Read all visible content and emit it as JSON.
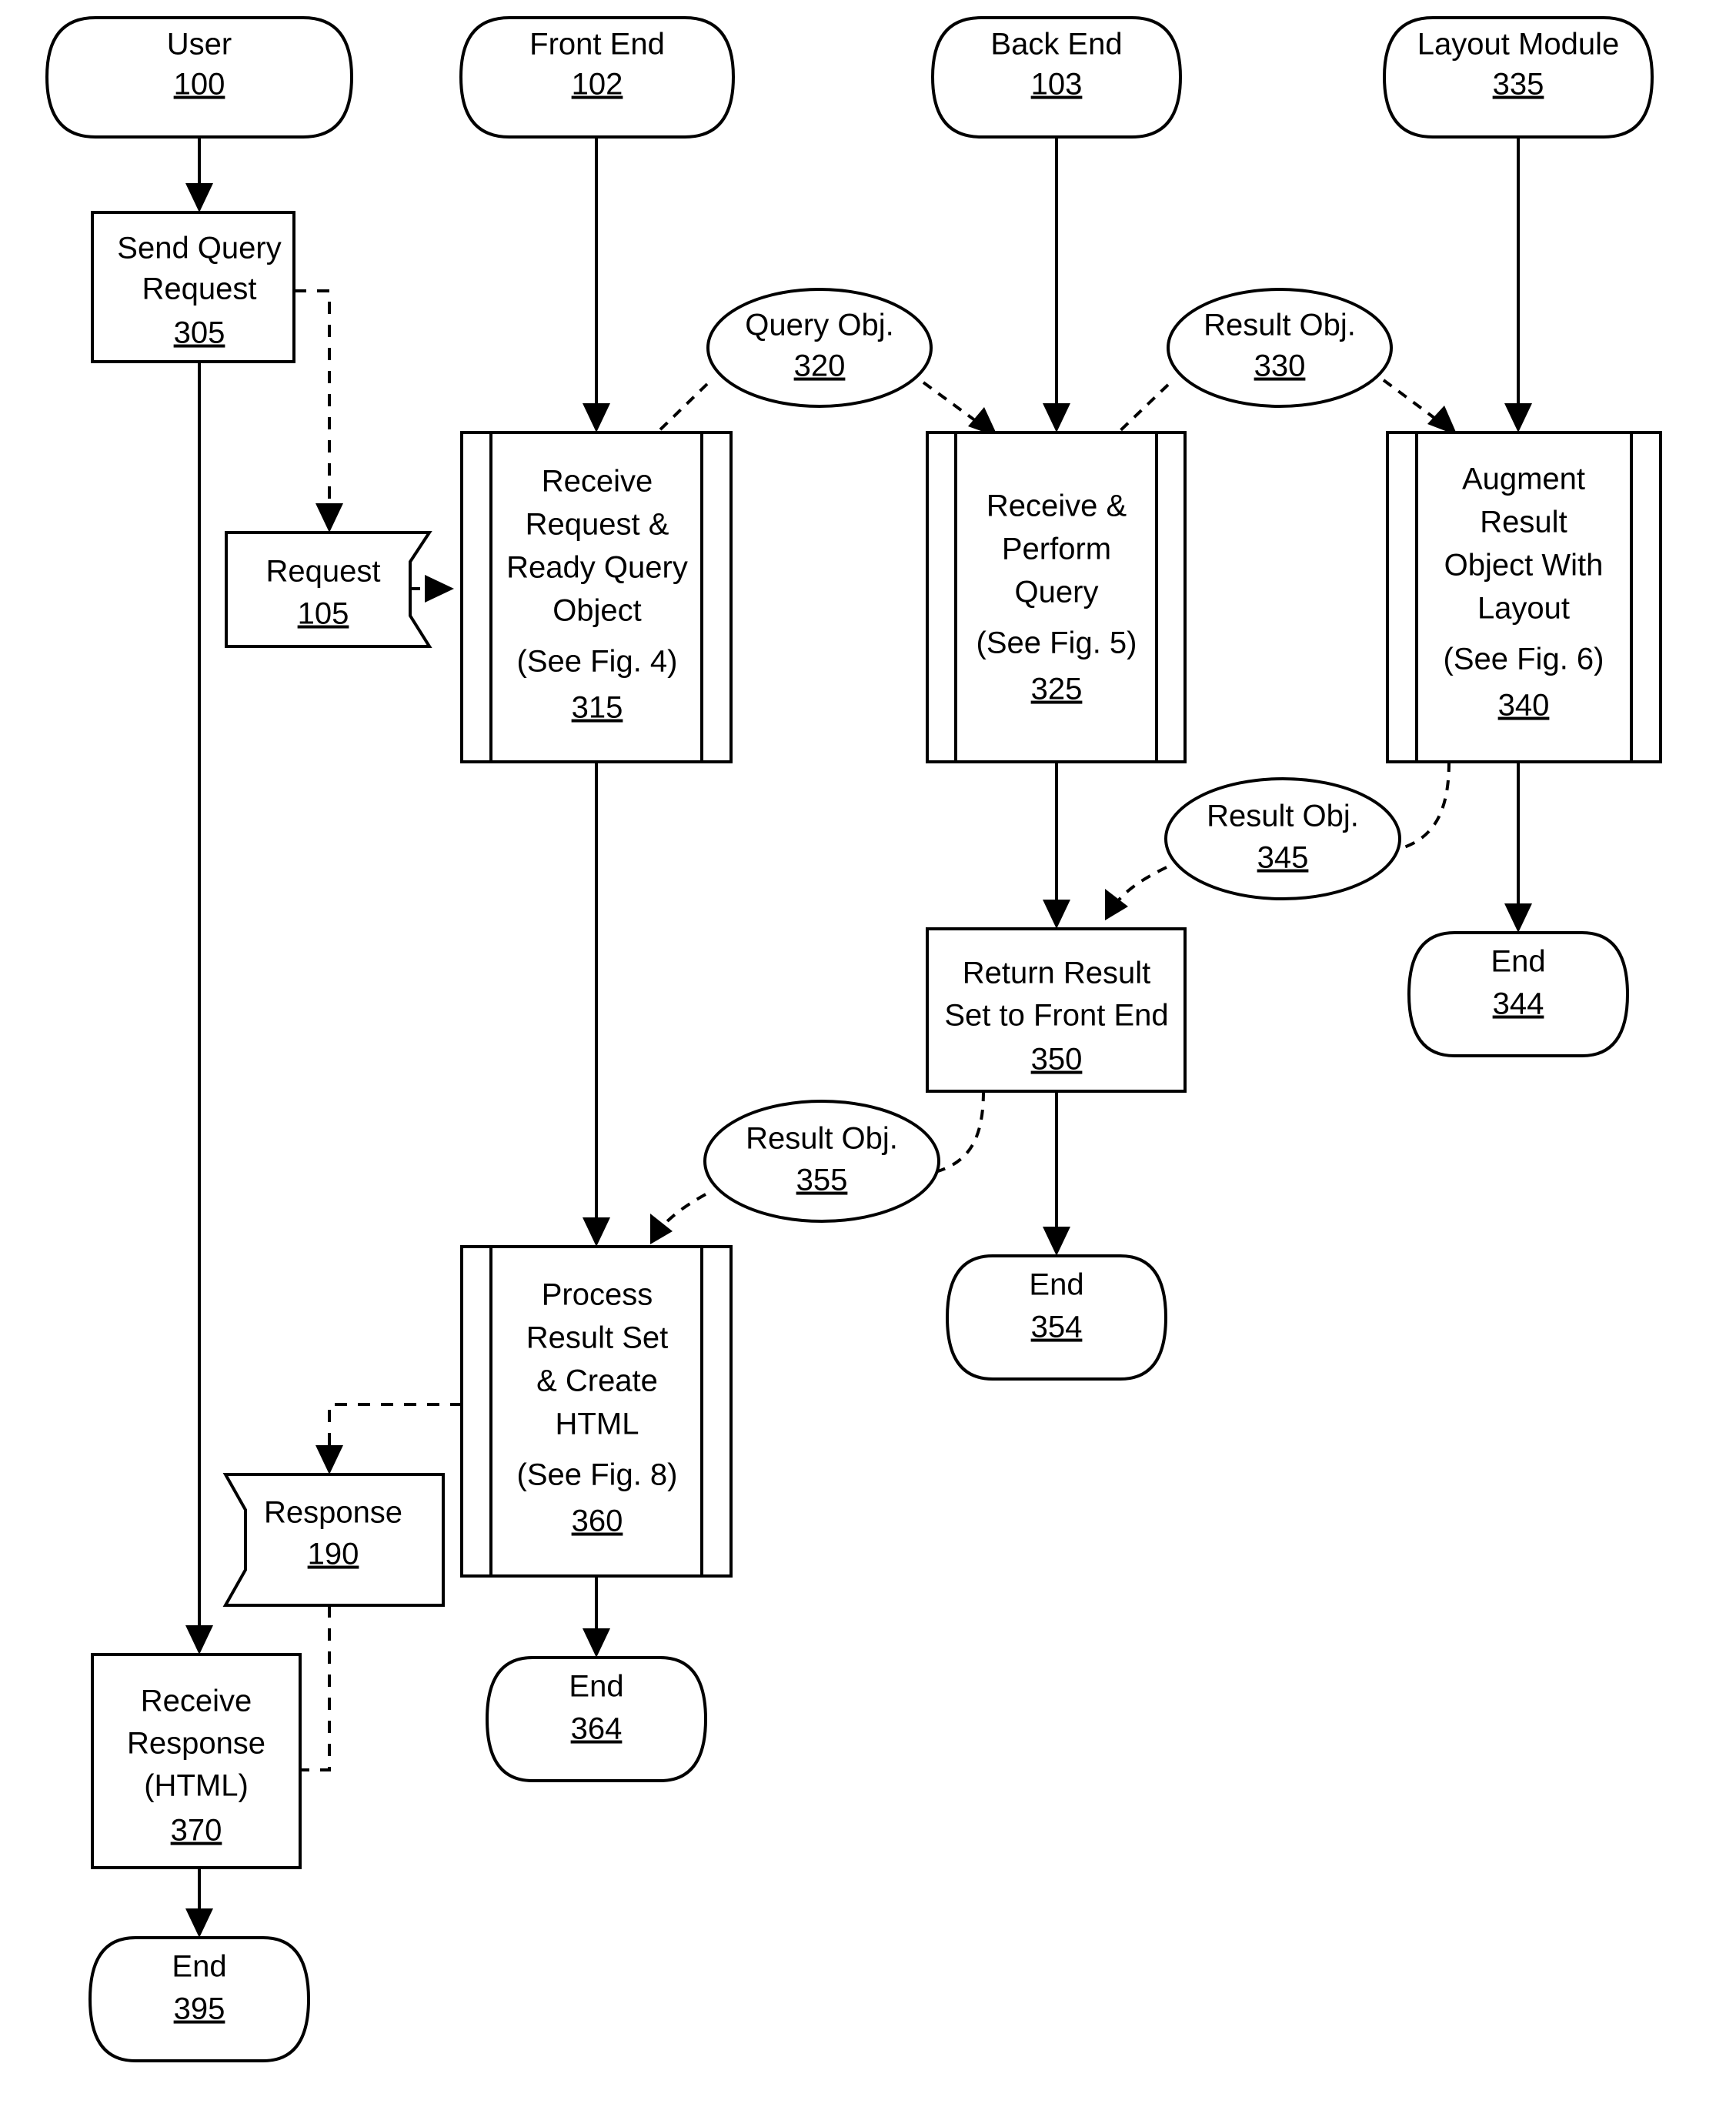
{
  "figure": {
    "type": "patent-flowchart",
    "background_color": "#ffffff",
    "line_color": "#000000"
  },
  "lanes": [
    {
      "name": "user",
      "label": "User",
      "number": "100"
    },
    {
      "name": "front-end",
      "label": "Front End",
      "number": "102"
    },
    {
      "name": "back-end",
      "label": "Back End",
      "number": "103"
    },
    {
      "name": "layout-module",
      "label": "Layout Module",
      "number": "335"
    }
  ],
  "nodes": {
    "send_query_request": {
      "lines": [
        "Send Query",
        "Request"
      ],
      "number": "305",
      "shape": "process"
    },
    "request_doc": {
      "lines": [
        "Request"
      ],
      "number": "105",
      "shape": "flag-right-notch"
    },
    "receive_request_ready_query": {
      "lines": [
        "Receive",
        "Request &",
        "Ready Query",
        "Object",
        "(See Fig. 4)"
      ],
      "number": "315",
      "shape": "predefined-process"
    },
    "query_obj": {
      "lines": [
        "Query Obj."
      ],
      "number": "320",
      "shape": "ellipse"
    },
    "receive_perform_query": {
      "lines": [
        "Receive &",
        "Perform",
        "Query",
        "(See Fig. 5)"
      ],
      "number": "325",
      "shape": "predefined-process"
    },
    "result_obj_330": {
      "lines": [
        "Result Obj."
      ],
      "number": "330",
      "shape": "ellipse"
    },
    "augment_result_object": {
      "lines": [
        "Augment",
        "Result",
        "Object With",
        "Layout",
        "(See Fig. 6)"
      ],
      "number": "340",
      "shape": "predefined-process"
    },
    "end_344": {
      "lines": [
        "End"
      ],
      "number": "344",
      "shape": "terminator"
    },
    "result_obj_345": {
      "lines": [
        "Result Obj."
      ],
      "number": "345",
      "shape": "ellipse"
    },
    "return_result_set": {
      "lines": [
        "Return Result",
        "Set to Front End"
      ],
      "number": "350",
      "shape": "process"
    },
    "end_354": {
      "lines": [
        "End"
      ],
      "number": "354",
      "shape": "terminator"
    },
    "result_obj_355": {
      "lines": [
        "Result Obj."
      ],
      "number": "355",
      "shape": "ellipse"
    },
    "process_result_set": {
      "lines": [
        "Process",
        "Result Set",
        "& Create",
        "HTML",
        "(See Fig. 8)"
      ],
      "number": "360",
      "shape": "predefined-process"
    },
    "end_364": {
      "lines": [
        "End"
      ],
      "number": "364",
      "shape": "terminator"
    },
    "response_doc": {
      "lines": [
        "Response"
      ],
      "number": "190",
      "shape": "flag-left-notch"
    },
    "receive_response": {
      "lines": [
        "Receive",
        "Response",
        "(HTML)"
      ],
      "number": "370",
      "shape": "process"
    },
    "end_395": {
      "lines": [
        "End"
      ],
      "number": "395",
      "shape": "terminator"
    }
  }
}
